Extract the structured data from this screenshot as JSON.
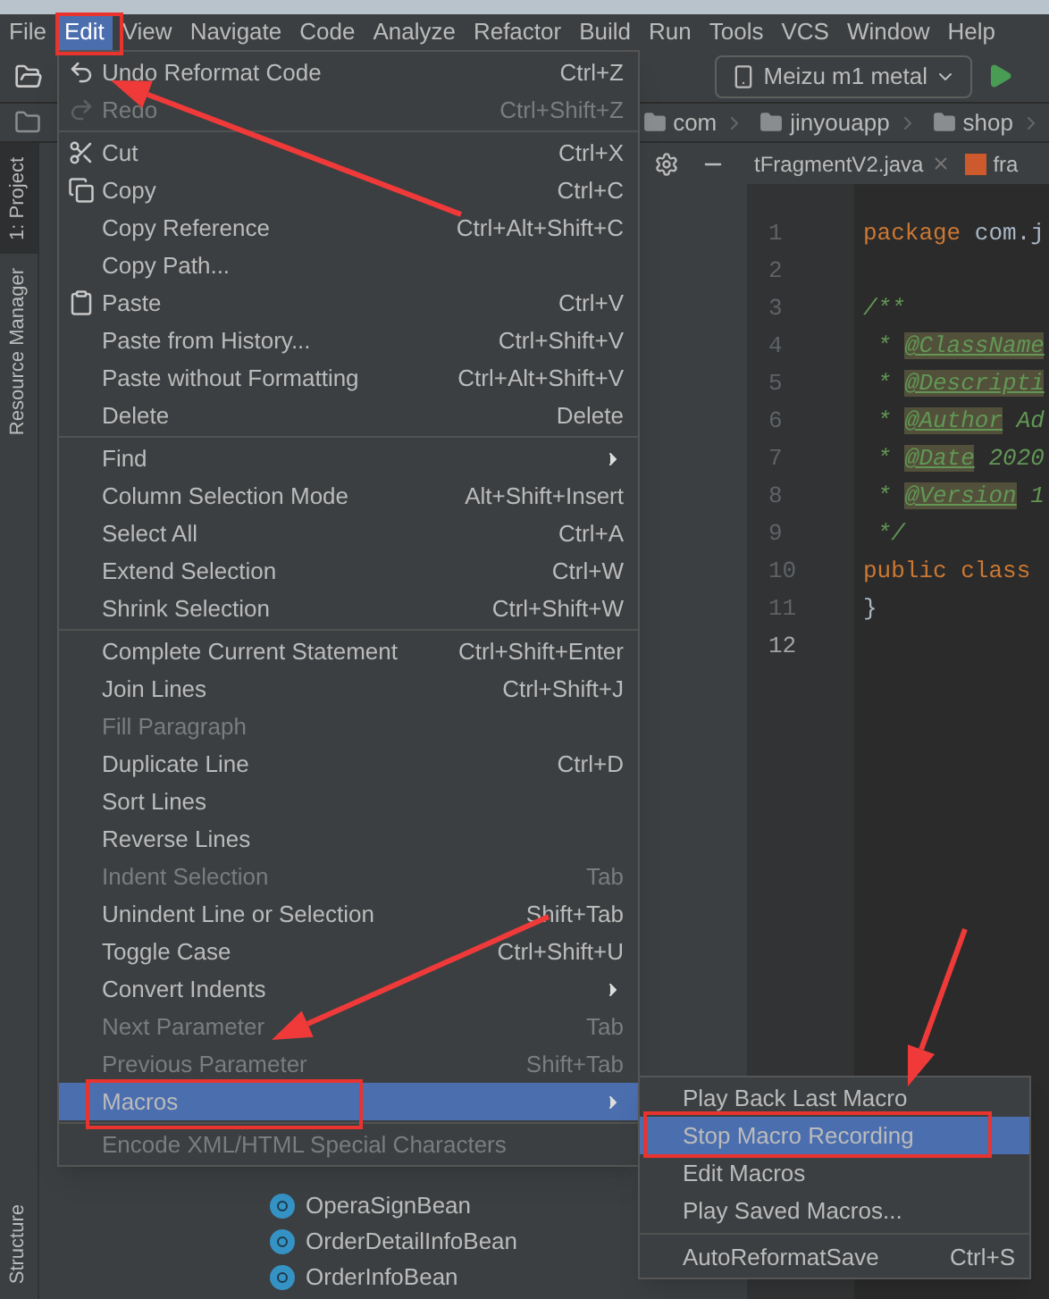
{
  "menubar": [
    {
      "label": "File",
      "selected": false
    },
    {
      "label": "Edit",
      "selected": true
    },
    {
      "label": "View",
      "selected": false
    },
    {
      "label": "Navigate",
      "selected": false
    },
    {
      "label": "Code",
      "selected": false
    },
    {
      "label": "Analyze",
      "selected": false
    },
    {
      "label": "Refactor",
      "selected": false
    },
    {
      "label": "Build",
      "selected": false
    },
    {
      "label": "Run",
      "selected": false
    },
    {
      "label": "Tools",
      "selected": false
    },
    {
      "label": "VCS",
      "selected": false
    },
    {
      "label": "Window",
      "selected": false
    },
    {
      "label": "Help",
      "selected": false
    }
  ],
  "toolbar": {
    "device": "Meizu m1 metal"
  },
  "breadcrumbs": [
    "com",
    "jinyouapp",
    "shop"
  ],
  "side_tabs": [
    {
      "label": "1: Project",
      "selected": true
    },
    {
      "label": "Resource Manager",
      "selected": false
    },
    {
      "label": "Structure",
      "selected": false
    }
  ],
  "project_tree": [
    "OperaSignBean",
    "OrderDetailInfoBean",
    "OrderInfoBean"
  ],
  "editor_tabs": [
    {
      "label": "tFragmentV2.java",
      "kind": "java"
    },
    {
      "label": "fra",
      "kind": "xml"
    }
  ],
  "code": [
    {
      "number": "1",
      "tokens": [
        {
          "kind": "keyword",
          "text": "package "
        },
        {
          "kind": "plain",
          "text": "com.j"
        }
      ]
    },
    {
      "number": "2"
    },
    {
      "number": "3",
      "tokens": [
        {
          "kind": "comment",
          "text": "/**"
        }
      ]
    },
    {
      "number": "4",
      "tokens": [
        {
          "kind": "comment",
          "text": " * "
        },
        {
          "kind": "doctag",
          "text": "@ClassName"
        }
      ]
    },
    {
      "number": "5",
      "tokens": [
        {
          "kind": "comment",
          "text": " * "
        },
        {
          "kind": "doctag",
          "text": "@Descripti"
        }
      ]
    },
    {
      "number": "6",
      "tokens": [
        {
          "kind": "comment",
          "text": " * "
        },
        {
          "kind": "doctag",
          "text": "@Author"
        },
        {
          "kind": "comment",
          "text": " Ad"
        }
      ]
    },
    {
      "number": "7",
      "tokens": [
        {
          "kind": "comment",
          "text": " * "
        },
        {
          "kind": "doctag",
          "text": "@Date"
        },
        {
          "kind": "comment",
          "text": " 2020"
        }
      ]
    },
    {
      "number": "8",
      "tokens": [
        {
          "kind": "comment",
          "text": " * "
        },
        {
          "kind": "doctag",
          "text": "@Version"
        },
        {
          "kind": "comment",
          "text": " 1"
        }
      ]
    },
    {
      "number": "9",
      "tokens": [
        {
          "kind": "comment",
          "text": " */"
        }
      ]
    },
    {
      "number": "10",
      "tokens": [
        {
          "kind": "keyword",
          "text": "public class"
        }
      ]
    },
    {
      "number": "11",
      "tokens": [
        {
          "kind": "plain",
          "text": "}"
        }
      ]
    },
    {
      "number": "12"
    }
  ],
  "edit_menu": [
    {
      "kind": "undo",
      "label": "Undo Reformat Code",
      "shortcut": "Ctrl+Z",
      "disabled": false,
      "selected": false,
      "submenu": false
    },
    {
      "kind": "redo",
      "label": "Redo",
      "shortcut": "Ctrl+Shift+Z",
      "disabled": true,
      "selected": false,
      "submenu": false
    },
    {
      "kind": "separator"
    },
    {
      "kind": "cut",
      "label": "Cut",
      "shortcut": "Ctrl+X",
      "disabled": false,
      "selected": false,
      "submenu": false
    },
    {
      "kind": "copy",
      "label": "Copy",
      "shortcut": "Ctrl+C",
      "disabled": false,
      "selected": false,
      "submenu": false
    },
    {
      "kind": "item",
      "label": "Copy Reference",
      "shortcut": "Ctrl+Alt+Shift+C",
      "disabled": false,
      "selected": false,
      "submenu": false
    },
    {
      "kind": "item",
      "label": "Copy Path...",
      "disabled": false,
      "selected": false,
      "submenu": false
    },
    {
      "kind": "paste",
      "label": "Paste",
      "shortcut": "Ctrl+V",
      "disabled": false,
      "selected": false,
      "submenu": false
    },
    {
      "kind": "item",
      "label": "Paste from History...",
      "shortcut": "Ctrl+Shift+V",
      "disabled": false,
      "selected": false,
      "submenu": false
    },
    {
      "kind": "item",
      "label": "Paste without Formatting",
      "shortcut": "Ctrl+Alt+Shift+V",
      "disabled": false,
      "selected": false,
      "submenu": false
    },
    {
      "kind": "item",
      "label": "Delete",
      "shortcut": "Delete",
      "disabled": false,
      "selected": false,
      "submenu": false
    },
    {
      "kind": "separator"
    },
    {
      "kind": "item",
      "label": "Find",
      "disabled": false,
      "selected": false,
      "submenu": true
    },
    {
      "kind": "item",
      "label": "Column Selection Mode",
      "shortcut": "Alt+Shift+Insert",
      "disabled": false,
      "selected": false,
      "submenu": false
    },
    {
      "kind": "item",
      "label": "Select All",
      "shortcut": "Ctrl+A",
      "disabled": false,
      "selected": false,
      "submenu": false
    },
    {
      "kind": "item",
      "label": "Extend Selection",
      "shortcut": "Ctrl+W",
      "disabled": false,
      "selected": false,
      "submenu": false
    },
    {
      "kind": "item",
      "label": "Shrink Selection",
      "shortcut": "Ctrl+Shift+W",
      "disabled": false,
      "selected": false,
      "submenu": false
    },
    {
      "kind": "separator"
    },
    {
      "kind": "item",
      "label": "Complete Current Statement",
      "shortcut": "Ctrl+Shift+Enter",
      "disabled": false,
      "selected": false,
      "submenu": false
    },
    {
      "kind": "item",
      "label": "Join Lines",
      "shortcut": "Ctrl+Shift+J",
      "disabled": false,
      "selected": false,
      "submenu": false
    },
    {
      "kind": "item",
      "label": "Fill Paragraph",
      "disabled": true,
      "selected": false,
      "submenu": false
    },
    {
      "kind": "item",
      "label": "Duplicate Line",
      "shortcut": "Ctrl+D",
      "disabled": false,
      "selected": false,
      "submenu": false
    },
    {
      "kind": "item",
      "label": "Sort Lines",
      "disabled": false,
      "selected": false,
      "submenu": false
    },
    {
      "kind": "item",
      "label": "Reverse Lines",
      "disabled": false,
      "selected": false,
      "submenu": false
    },
    {
      "kind": "item",
      "label": "Indent Selection",
      "shortcut": "Tab",
      "disabled": true,
      "selected": false,
      "submenu": false
    },
    {
      "kind": "item",
      "label": "Unindent Line or Selection",
      "shortcut": "Shift+Tab",
      "disabled": false,
      "selected": false,
      "submenu": false
    },
    {
      "kind": "item",
      "label": "Toggle Case",
      "shortcut": "Ctrl+Shift+U",
      "disabled": false,
      "selected": false,
      "submenu": false
    },
    {
      "kind": "item",
      "label": "Convert Indents",
      "disabled": false,
      "selected": false,
      "submenu": true
    },
    {
      "kind": "item",
      "label": "Next Parameter",
      "shortcut": "Tab",
      "disabled": true,
      "selected": false,
      "submenu": false
    },
    {
      "kind": "item",
      "label": "Previous Parameter",
      "shortcut": "Shift+Tab",
      "disabled": true,
      "selected": false,
      "submenu": false
    },
    {
      "kind": "item",
      "label": "Macros",
      "disabled": false,
      "selected": true,
      "submenu": true
    },
    {
      "kind": "separator"
    },
    {
      "kind": "item",
      "label": "Encode XML/HTML Special Characters",
      "disabled": true,
      "selected": false,
      "submenu": false
    }
  ],
  "macros_menu": [
    {
      "kind": "item",
      "label": "Play Back Last Macro",
      "disabled": false,
      "selected": false
    },
    {
      "kind": "item",
      "label": "Stop Macro Recording",
      "disabled": false,
      "selected": true
    },
    {
      "kind": "item",
      "label": "Edit Macros",
      "disabled": false,
      "selected": false
    },
    {
      "kind": "item",
      "label": "Play Saved Macros...",
      "disabled": false,
      "selected": false
    },
    {
      "kind": "separator"
    },
    {
      "kind": "item",
      "label": "AutoReformatSave",
      "shortcut": "Ctrl+S",
      "disabled": false,
      "selected": false
    }
  ]
}
